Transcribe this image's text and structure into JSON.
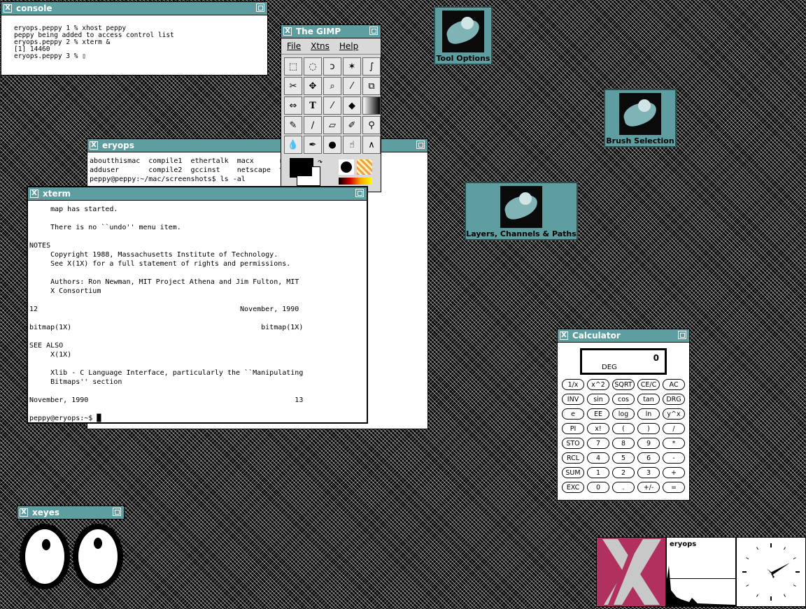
{
  "console": {
    "title": "console",
    "lines": "eryops.peppy 1 % xhost peppy\npeppy being added to access control list\neryops.peppy 2 % xterm &\n[1] 14460\neryops.peppy 3 % ▯"
  },
  "gimp": {
    "title": "The GIMP",
    "menu": [
      "File",
      "Xtns",
      "Help"
    ]
  },
  "icons": {
    "tool_options": "Tool Options",
    "brush_selection": "Brush Selection",
    "layers": "Layers, Channels & Paths"
  },
  "eryops": {
    "title": "eryops",
    "lines": "aboutthismac  compile1  ethertalk  macx      r\nadduser       compile2  gccinst    netscape  t\npeppy@peppy:~/mac/screenshots$ ls -al"
  },
  "xterm": {
    "title": "xterm",
    "lines": "     map has started.\n\n     There is no ``undo'' menu item.\n\nNOTES\n     Copyright 1988, Massachusetts Institute of Technology.\n     See X(1X) for a full statement of rights and permissions.\n\n     Authors: Ron Newman, MIT Project Athena and Jim Fulton, MIT\n     X Consortium\n\n12                                                November, 1990\n\nbitmap(1X)                                             bitmap(1X)\n\nSEE ALSO\n     X(1X)\n\n     Xlib - C Language Interface, particularly the ``Manipulating\n     Bitmaps'' section\n\nNovember, 1990                                                 13\n\npeppy@eryops:~$ █"
  },
  "calculator": {
    "title": "Calculator",
    "display_value": "0",
    "display_mode": "DEG",
    "keys": [
      "1/x",
      "x^2",
      "SQRT",
      "CE/C",
      "AC",
      "INV",
      "sin",
      "cos",
      "tan",
      "DRG",
      "e",
      "EE",
      "log",
      "ln",
      "y^x",
      "PI",
      "x!",
      "(",
      ")",
      "/",
      "STO",
      "7",
      "8",
      "9",
      "*",
      "RCL",
      "4",
      "5",
      "6",
      "-",
      "SUM",
      "1",
      "2",
      "3",
      "+",
      "EXC",
      "0",
      ".",
      "+/-",
      "="
    ]
  },
  "xeyes": {
    "title": "xeyes"
  },
  "xload": {
    "host": "eryops"
  },
  "colors": {
    "titlebar": "#5f9ea0",
    "xlogo_bg": "#b03060"
  }
}
